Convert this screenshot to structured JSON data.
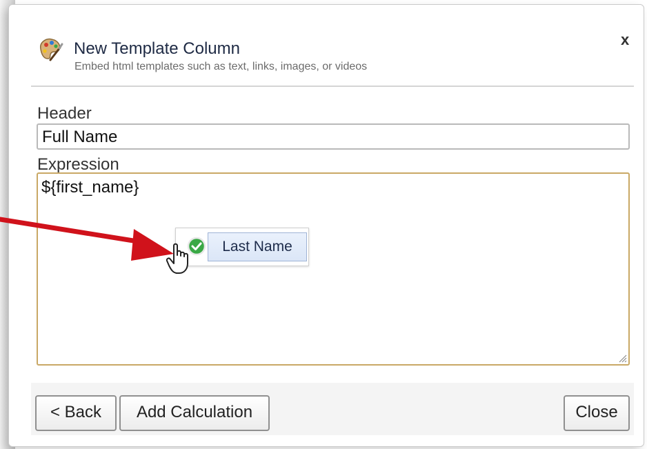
{
  "dialog": {
    "title": "New Template Column",
    "subtitle": "Embed html templates such as text, links, images, or videos",
    "close_label": "x"
  },
  "form": {
    "header_label": "Header",
    "header_value": "Full Name",
    "expression_label": "Expression",
    "expression_value": "${first_name}"
  },
  "drag": {
    "field_label": "Last Name"
  },
  "buttons": {
    "back_label": "< Back",
    "add_calculation_label": "Add Calculation",
    "close_label": "Close"
  },
  "colors": {
    "annotation_arrow": "#d0121b",
    "expression_border": "#c9a865",
    "chip_border": "#9fb3d6",
    "success_icon": "#3aa845"
  },
  "icons": {
    "title_icon": "palette-brush-icon",
    "drop_status_icon": "check-circle-icon",
    "cursor_icon": "hand-cursor-icon",
    "resize_icon": "resize-grip-icon"
  }
}
